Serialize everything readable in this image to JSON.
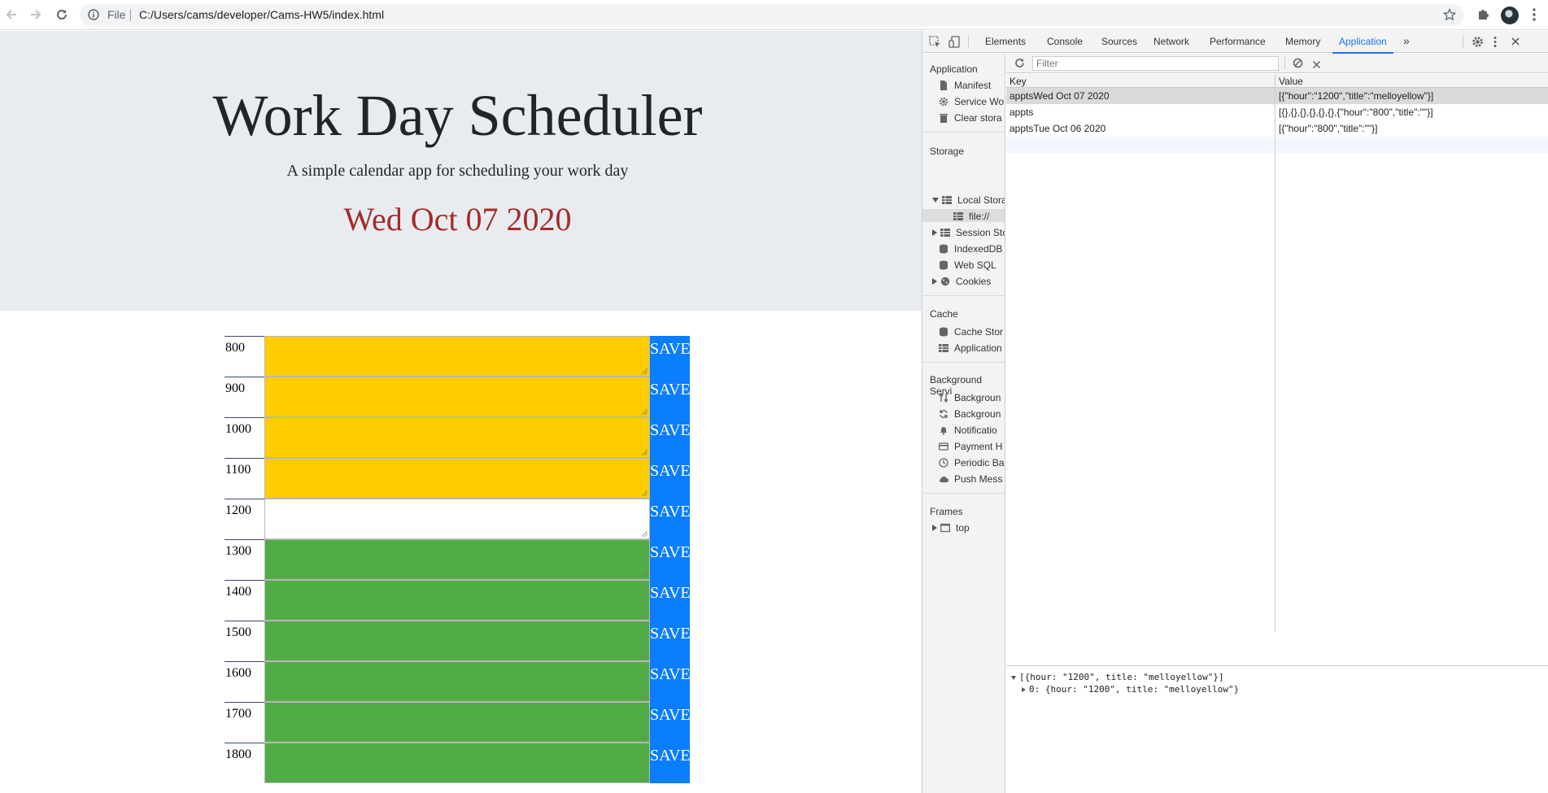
{
  "browser": {
    "scheme": "File",
    "url": "C:/Users/cams/developer/Cams-HW5/index.html"
  },
  "header": {
    "title": "Work Day Scheduler",
    "lead": "A simple calendar app for scheduling your work day",
    "date": "Wed Oct 07 2020"
  },
  "rows": [
    {
      "hour": "800",
      "state": "past",
      "save": "SAVE"
    },
    {
      "hour": "900",
      "state": "past",
      "save": "SAVE"
    },
    {
      "hour": "1000",
      "state": "past",
      "save": "SAVE"
    },
    {
      "hour": "1100",
      "state": "past",
      "save": "SAVE"
    },
    {
      "hour": "1200",
      "state": "present",
      "save": "SAVE"
    },
    {
      "hour": "1300",
      "state": "future",
      "save": "SAVE"
    },
    {
      "hour": "1400",
      "state": "future",
      "save": "SAVE"
    },
    {
      "hour": "1500",
      "state": "future",
      "save": "SAVE"
    },
    {
      "hour": "1600",
      "state": "future",
      "save": "SAVE"
    },
    {
      "hour": "1700",
      "state": "future",
      "save": "SAVE"
    },
    {
      "hour": "1800",
      "state": "future",
      "save": "SAVE"
    }
  ],
  "colors": {
    "past": "#ffcc00",
    "present": "#ffffff",
    "future": "#52ac45",
    "save": "#0b7dff",
    "date": "#a52a2a"
  },
  "devtools": {
    "tabs": [
      "Elements",
      "Console",
      "Sources",
      "Network",
      "Performance",
      "Memory",
      "Application"
    ],
    "active_tab": "Application",
    "more": "»",
    "sidebar": {
      "application_head": "Application",
      "application_items": [
        "Manifest",
        "Service Wo",
        "Clear stora"
      ],
      "storage_head": "Storage",
      "local_storage": "Local Stora",
      "local_storage_child": "file://",
      "session_storage": "Session Sto",
      "indexeddb": "IndexedDB",
      "websql": "Web SQL",
      "cookies": "Cookies",
      "cache_head": "Cache",
      "cache_items": [
        "Cache Stor",
        "Application"
      ],
      "bg_head": "Background Servi",
      "bg_items": [
        "Backgroun",
        "Backgroun",
        "Notificatio",
        "Payment H",
        "Periodic Ba",
        "Push Mess"
      ],
      "frames_head": "Frames",
      "frames_top": "top"
    },
    "filter_placeholder": "Filter",
    "grid": {
      "key_header": "Key",
      "value_header": "Value",
      "rows": [
        {
          "key": "apptsWed Oct 07 2020",
          "value": "[{\"hour\":\"1200\",\"title\":\"melloyellow\"}]"
        },
        {
          "key": "appts",
          "value": "[{},{},{},{},{},{},{\"hour\":\"800\",\"title\":\"\"}]"
        },
        {
          "key": "apptsTue Oct 06 2020",
          "value": "[{\"hour\":\"800\",\"title\":\"\"}]"
        }
      ]
    },
    "preview": {
      "line1": "[{hour: \"1200\", title: \"melloyellow\"}]",
      "line2": "0: {hour: \"1200\", title: \"melloyellow\"}"
    }
  }
}
